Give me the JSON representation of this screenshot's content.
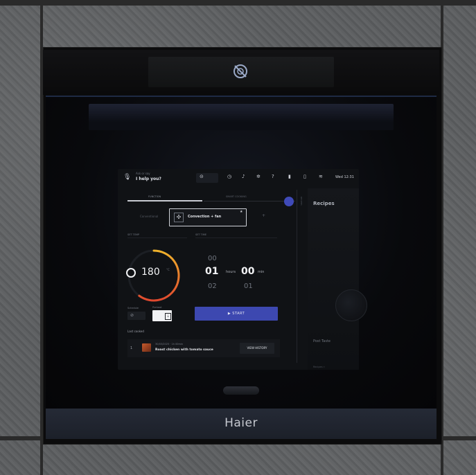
{
  "brand": "Haier",
  "topbar": {
    "ask_hint": "Ask or say",
    "ask_text": "I help you?",
    "datetime": "Wed 12:31",
    "icons": [
      "lock-icon",
      "timer-icon",
      "bell-icon",
      "gear-icon",
      "help-icon",
      "probe-icon",
      "light-icon",
      "wifi-icon"
    ]
  },
  "tabs": {
    "function": "FUNCTION",
    "other": "SMART COOKING"
  },
  "function_selector": {
    "left": "Conventional",
    "selected": "Convection + fan",
    "right": "+"
  },
  "labels": {
    "set_temp": "SET TEMP",
    "set_time": "SET TIME",
    "last_cooked": "Last cooked",
    "option1": "Schedule",
    "option2": "Preheat",
    "side": "RECIPES"
  },
  "temperature": {
    "value": "180",
    "unit": "°C",
    "level": 0.6
  },
  "time": {
    "hours_prev": "00",
    "hours": "01",
    "hours_label": "hours",
    "minutes": "00",
    "minutes_label": "min",
    "hours_next": "02",
    "minutes_next": "01"
  },
  "start_button": "▶ START",
  "history": {
    "number": "1",
    "date": "30/03/2025 · 1h 00min",
    "title": "Roast chicken with tomato sauce",
    "button": "VIEW HISTORY"
  },
  "recipes": {
    "title": "Recipes",
    "post_text": "Post Taste",
    "footer": "Recipes »"
  },
  "colors": {
    "accent": "#3d48b0",
    "dial_start": "#f0b32b",
    "dial_end": "#e0482e"
  }
}
